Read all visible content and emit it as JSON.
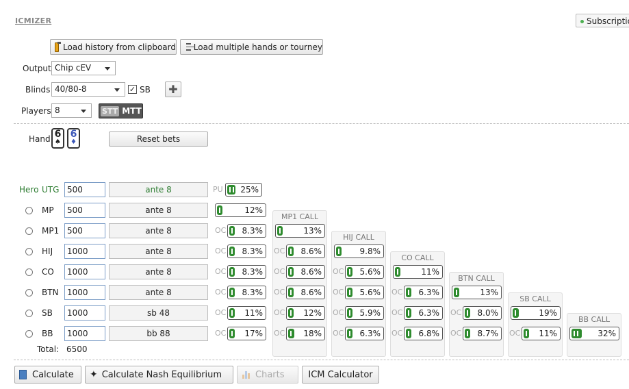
{
  "app": {
    "brand": "ICMIZER",
    "subscription": "Subscriptio"
  },
  "toolbar": {
    "load_clipboard": "Load history from clipboard",
    "load_multiple": "Load multiple hands or tourney"
  },
  "settings": {
    "output_label": "Output",
    "output_value": "Chip cEV",
    "blinds_label": "Blinds",
    "blinds_value": "40/80-8",
    "sb_label": "SB",
    "sb_checked": true,
    "players_label": "Players",
    "players_value": "8",
    "stt_label": "STT",
    "mtt_label": "MTT"
  },
  "hand": {
    "label": "Hand",
    "cards": [
      {
        "rank": "6",
        "suit": "♠",
        "color": "#222"
      },
      {
        "rank": "6",
        "suit": "♦",
        "color": "#3b57b8"
      }
    ],
    "reset": "Reset bets"
  },
  "players": [
    {
      "pos": "UTG",
      "hero": "Hero",
      "stack": "500",
      "bet": "ante 8"
    },
    {
      "pos": "MP",
      "stack": "500",
      "bet": "ante 8"
    },
    {
      "pos": "MP1",
      "stack": "500",
      "bet": "ante 8"
    },
    {
      "pos": "HIJ",
      "stack": "1000",
      "bet": "ante 8"
    },
    {
      "pos": "CO",
      "stack": "1000",
      "bet": "ante 8"
    },
    {
      "pos": "BTN",
      "stack": "1000",
      "bet": "ante 8"
    },
    {
      "pos": "SB",
      "stack": "1000",
      "bet": "sb 48"
    },
    {
      "pos": "BB",
      "stack": "1000",
      "bet": "bb 88"
    }
  ],
  "total": {
    "label": "Total:",
    "value": "6500"
  },
  "ranges": {
    "push_label": "PU",
    "oc_label": "OC",
    "push": [
      "25%",
      "12%",
      "8.3%",
      "8.3%",
      "8.3%",
      "8.3%",
      "11%",
      "17%"
    ],
    "push_fill": [
      0.25,
      0.12,
      0.083,
      0.083,
      0.083,
      0.083,
      0.11,
      0.17
    ],
    "calls": [
      {
        "title": "MP1 CALL",
        "values": [
          "13%",
          "8.6%",
          "8.6%",
          "8.6%",
          "12%",
          "18%"
        ],
        "fill": [
          0.13,
          0.086,
          0.086,
          0.086,
          0.12,
          0.18
        ]
      },
      {
        "title": "HIJ CALL",
        "values": [
          "9.8%",
          "5.6%",
          "5.6%",
          "5.9%",
          "6.3%"
        ],
        "fill": [
          0.098,
          0.056,
          0.056,
          0.059,
          0.063
        ]
      },
      {
        "title": "CO CALL",
        "values": [
          "11%",
          "6.3%",
          "6.3%",
          "6.8%"
        ],
        "fill": [
          0.11,
          0.063,
          0.063,
          0.068
        ]
      },
      {
        "title": "BTN CALL",
        "values": [
          "13%",
          "8.0%",
          "8.7%"
        ],
        "fill": [
          0.13,
          0.08,
          0.087
        ]
      },
      {
        "title": "SB CALL",
        "values": [
          "19%",
          "11%"
        ],
        "fill": [
          0.19,
          0.11
        ]
      },
      {
        "title": "BB CALL",
        "values": [
          "32%"
        ],
        "fill": [
          0.32
        ]
      }
    ]
  },
  "bottom": {
    "calculate": "Calculate",
    "nash": "Calculate Nash Equilibrium",
    "charts": "Charts",
    "icm": "ICM Calculator"
  },
  "colors": {
    "accent": "#2e8b2e",
    "hero": "#2e7d32"
  }
}
